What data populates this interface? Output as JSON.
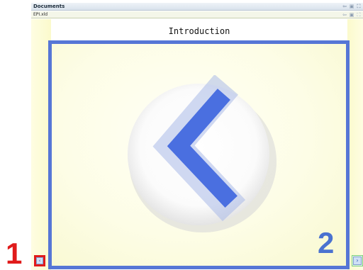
{
  "window": {
    "title": "Documents",
    "title_buttons": [
      "back-icon",
      "restore-icon",
      "maximize-icon"
    ]
  },
  "tab": {
    "filename": "EPI.xld",
    "buttons": [
      "back-icon",
      "restore-icon",
      "maximize-icon"
    ]
  },
  "document": {
    "page_title": "Introduction"
  },
  "navigation": {
    "prev_icon": "chevron-left-icon",
    "next_icon": "chevron-right-icon"
  },
  "annotations": {
    "marker_1": "1",
    "marker_2": "2",
    "marker_1_color": "#e01b1b",
    "marker_2_color": "#4a72d0"
  },
  "colors": {
    "content_border": "#5676d6",
    "page_background": "#fdfde6",
    "arrow": "#4a6fe0"
  }
}
